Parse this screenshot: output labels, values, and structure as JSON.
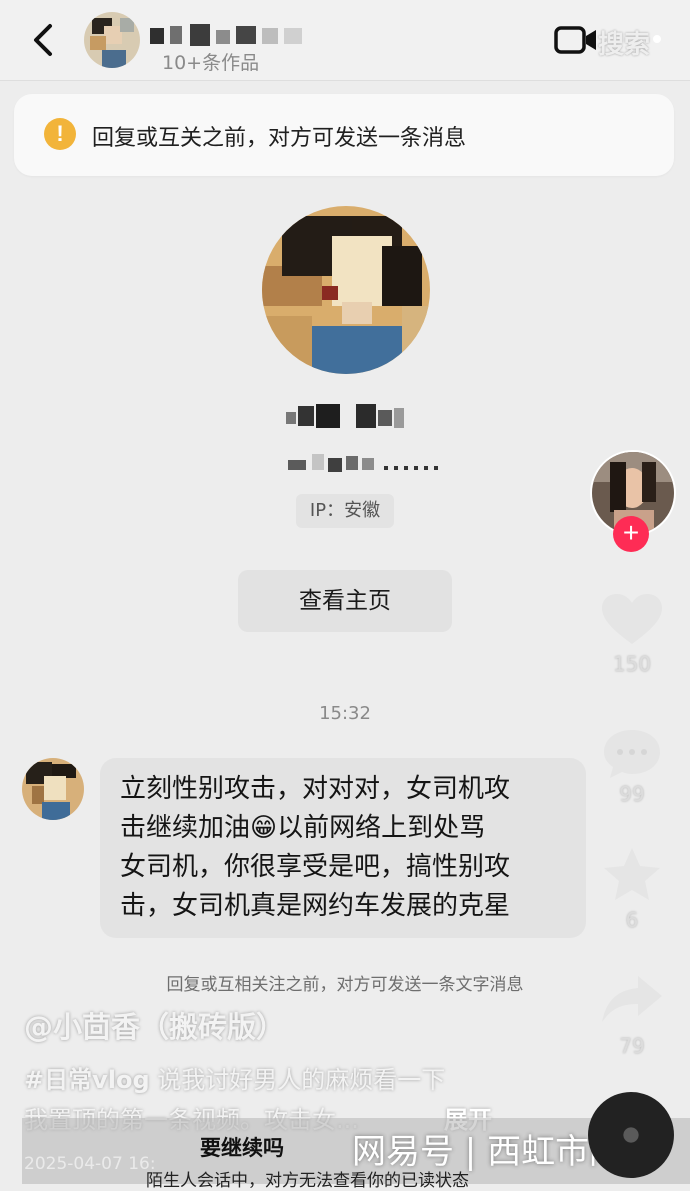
{
  "header": {
    "subtitle": "10+条作品",
    "search_label": "搜索",
    "icons": {
      "back": "chevron-left-icon",
      "video": "video-camera-icon",
      "more": "more-vertical-icon"
    }
  },
  "notice": {
    "text": "回复或互关之前，对方可发送一条消息",
    "icon": "warning-icon",
    "icon_color": "#f2b43a"
  },
  "profile": {
    "ip": "IP：安徽",
    "view_homepage_label": "查看主页"
  },
  "conversation": {
    "timestamp": "15:32",
    "message": "立刻性别攻击，对对对，女司机攻\n击继续加油😁以前网络上到处骂\n女司机，你很享受是吧，搞性别攻\n击，女司机真是网约车发展的克星",
    "footer_notice": "回复或互相关注之前，对方可发送一条文字消息"
  },
  "side_actions": {
    "like_count": "150",
    "comment_count": "99",
    "favorite_count": "6",
    "share_count": "79",
    "follow_color": "#fe2c55"
  },
  "video_overlay": {
    "author": "@小茴香（搬砖版）",
    "desc_tag": "#日常vlog",
    "desc_line1": " 说我讨好男人的麻烦看一下",
    "desc_line2": "我置顶的第一条视频。攻击女...",
    "expand_label": "展开",
    "continue_label": "要继续吗",
    "date": "2025-04-07 16:",
    "stranger_notice": "陌生人会话中，对方无法查看你的已读状态"
  },
  "watermark": "网易号 | 西虹市闲话"
}
